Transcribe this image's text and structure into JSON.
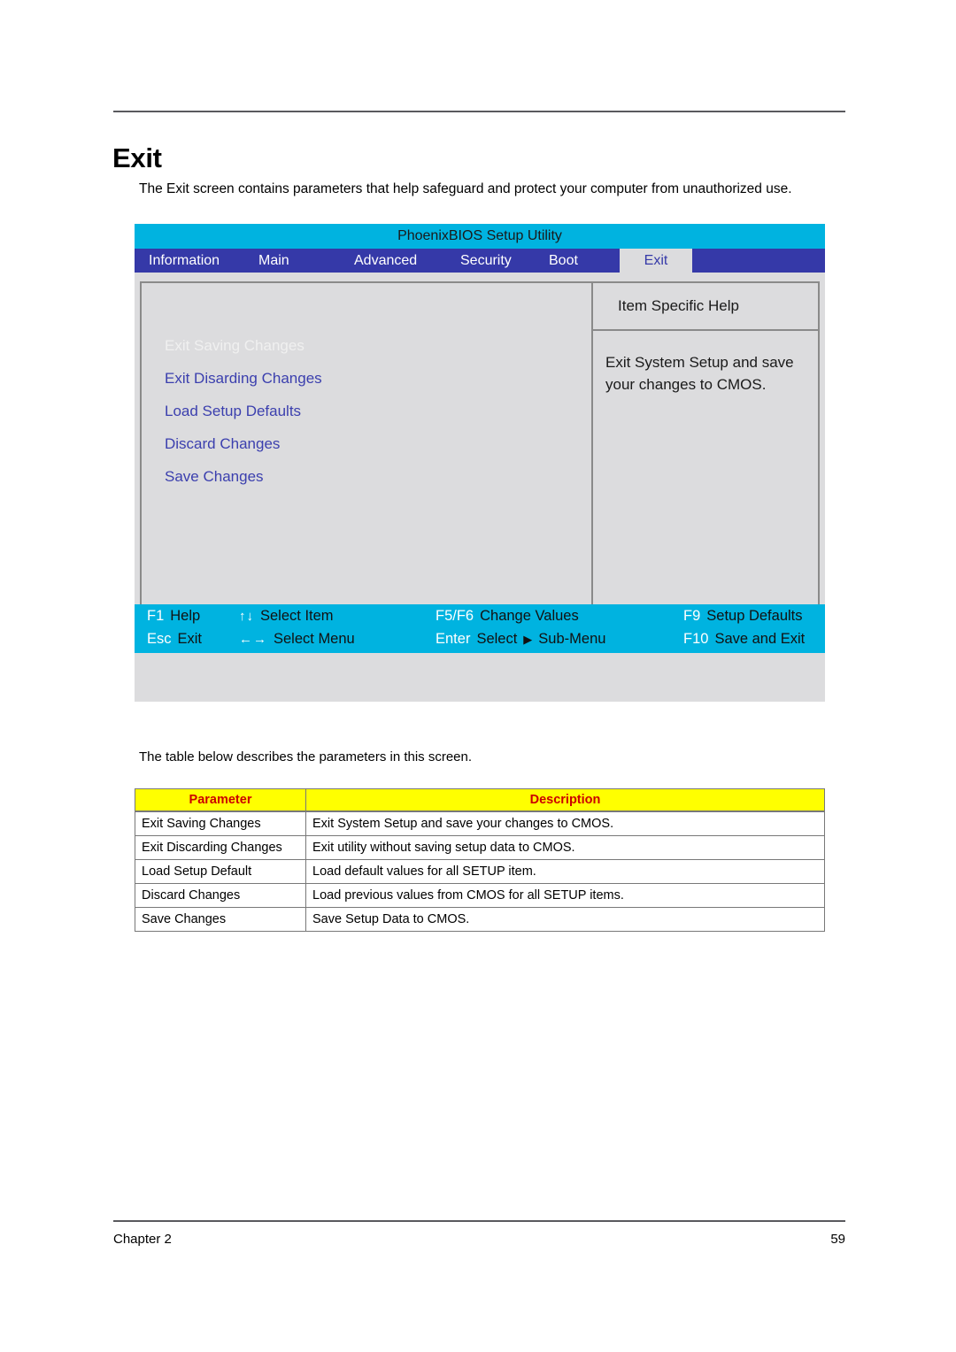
{
  "document": {
    "page_title": "Exit",
    "intro_paragraph": "The Exit screen contains parameters that help safeguard and protect your computer from unauthorized use.",
    "table_intro": "The table below describes the parameters in this screen.",
    "footer_left": "Chapter 2",
    "footer_right": "59"
  },
  "bios": {
    "title": "PhoenixBIOS Setup Utility",
    "tabs": [
      {
        "label": "Information",
        "active": false
      },
      {
        "label": "Main",
        "active": false
      },
      {
        "label": "Advanced",
        "active": false
      },
      {
        "label": "Security",
        "active": false
      },
      {
        "label": "Boot",
        "active": false
      },
      {
        "label": "Exit",
        "active": true
      }
    ],
    "menu_items": [
      {
        "label": "Exit Saving Changes",
        "selected": true
      },
      {
        "label": "Exit Disarding Changes",
        "selected": false
      },
      {
        "label": "Load Setup Defaults",
        "selected": false
      },
      {
        "label": "Discard Changes",
        "selected": false
      },
      {
        "label": "Save Changes",
        "selected": false
      }
    ],
    "help": {
      "header": "Item Specific Help",
      "body": "Exit System Setup and save your changes to CMOS."
    },
    "function_keys": {
      "row1": [
        {
          "key": "F1",
          "label": "Help"
        },
        {
          "key": "↑↓",
          "label": "Select Item"
        },
        {
          "key": "F5/F6",
          "label": "Change Values"
        },
        {
          "key": "F9",
          "label": "Setup Defaults"
        }
      ],
      "row2": [
        {
          "key": "Esc",
          "label": "Exit"
        },
        {
          "key": "←→",
          "label": "Select Menu"
        },
        {
          "key": "Enter",
          "label": "Select",
          "extra_icon": "▶",
          "extra_label": "Sub-Menu"
        },
        {
          "key": "F10",
          "label": "Save and Exit"
        }
      ]
    },
    "colors": {
      "titlebar": "#00b3e0",
      "tabbar": "#3539a8",
      "active_tab_bg": "#dcdcde",
      "active_tab_text": "#3539a8",
      "panel_bg": "#dcdcde",
      "menu_text": "#3b3fae",
      "selected_menu_text": "#f0f0f0",
      "fkey_bar": "#00b3e0"
    }
  },
  "table": {
    "headers": [
      "Parameter",
      "Description"
    ],
    "header_bg": "#ffff00",
    "header_color": "#cc0000",
    "rows": [
      {
        "parameter": "Exit Saving Changes",
        "description": "Exit System Setup and save your changes to CMOS."
      },
      {
        "parameter": "Exit Discarding Changes",
        "description": "Exit utility without saving setup data to CMOS."
      },
      {
        "parameter": "Load Setup Default",
        "description": "Load default values for all SETUP item."
      },
      {
        "parameter": "Discard Changes",
        "description": "Load previous values from CMOS for all SETUP items."
      },
      {
        "parameter": "Save Changes",
        "description": "Save Setup Data to CMOS."
      }
    ]
  }
}
